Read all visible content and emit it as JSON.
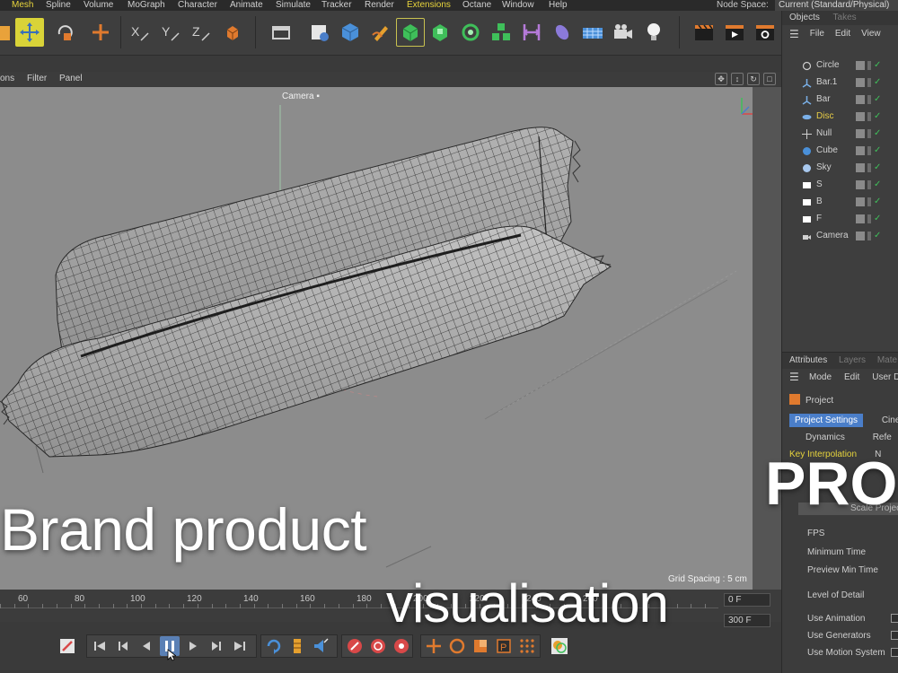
{
  "menubar": {
    "items": [
      "Mesh",
      "Spline",
      "Volume",
      "MoGraph",
      "Character",
      "Animate",
      "Simulate",
      "Tracker",
      "Render",
      "Extensions",
      "Octane",
      "Window",
      "Help"
    ],
    "node_space_label": "Node Space:",
    "node_space_value": "Current (Standard/Physical)"
  },
  "viewport": {
    "menu": [
      "ons",
      "Filter",
      "Panel"
    ],
    "camera_label": "Camera",
    "grid_spacing": "Grid Spacing : 5 cm"
  },
  "timeline": {
    "ticks": [
      "60",
      "80",
      "100",
      "120",
      "140",
      "160",
      "180",
      "200",
      "220",
      "240",
      "260"
    ],
    "current_frame": "0 F",
    "end_frame": "300 F"
  },
  "objects_panel": {
    "tabs": [
      "Objects",
      "Takes"
    ],
    "menu": [
      "File",
      "Edit",
      "View"
    ],
    "items": [
      {
        "name": "Circle",
        "icon": "circle-icon",
        "highlight": false
      },
      {
        "name": "Bar.1",
        "icon": "bone-icon",
        "highlight": false
      },
      {
        "name": "Bar",
        "icon": "bone-icon",
        "highlight": false
      },
      {
        "name": "Disc",
        "icon": "disc-icon",
        "highlight": true
      },
      {
        "name": "Null",
        "icon": "null-icon",
        "highlight": false
      },
      {
        "name": "Cube",
        "icon": "cube-icon",
        "highlight": false
      },
      {
        "name": "Sky",
        "icon": "sky-icon",
        "highlight": false
      },
      {
        "name": "S",
        "icon": "plane-icon",
        "highlight": false
      },
      {
        "name": "B",
        "icon": "plane-icon",
        "highlight": false
      },
      {
        "name": "F",
        "icon": "plane-icon",
        "highlight": false
      },
      {
        "name": "Camera",
        "icon": "camera-icon",
        "highlight": false
      }
    ]
  },
  "attributes_panel": {
    "tabs": [
      "Attributes",
      "Layers",
      "Mate"
    ],
    "menu": [
      "Mode",
      "Edit",
      "User D"
    ],
    "object_name": "Project",
    "tab_row1": [
      "Project Settings",
      "Cine"
    ],
    "tab_row2": [
      "Dynamics",
      "Refe"
    ],
    "key_interpolation": "Key Interpolation",
    "key_interpolation_suffix": "N",
    "scale_project": "Scale Project",
    "fields": [
      "FPS",
      "Minimum Time",
      "Preview Min Time",
      "Level of Detail",
      "Use Animation",
      "Use Generators",
      "Use Motion System"
    ]
  },
  "overlay": {
    "title": "Brand product",
    "subtitle": "visualisation",
    "corner": "PRO"
  },
  "colors": {
    "highlight": "#e7d43c",
    "selection": "#4a7ec9",
    "viewport": "#8c8c8c"
  }
}
